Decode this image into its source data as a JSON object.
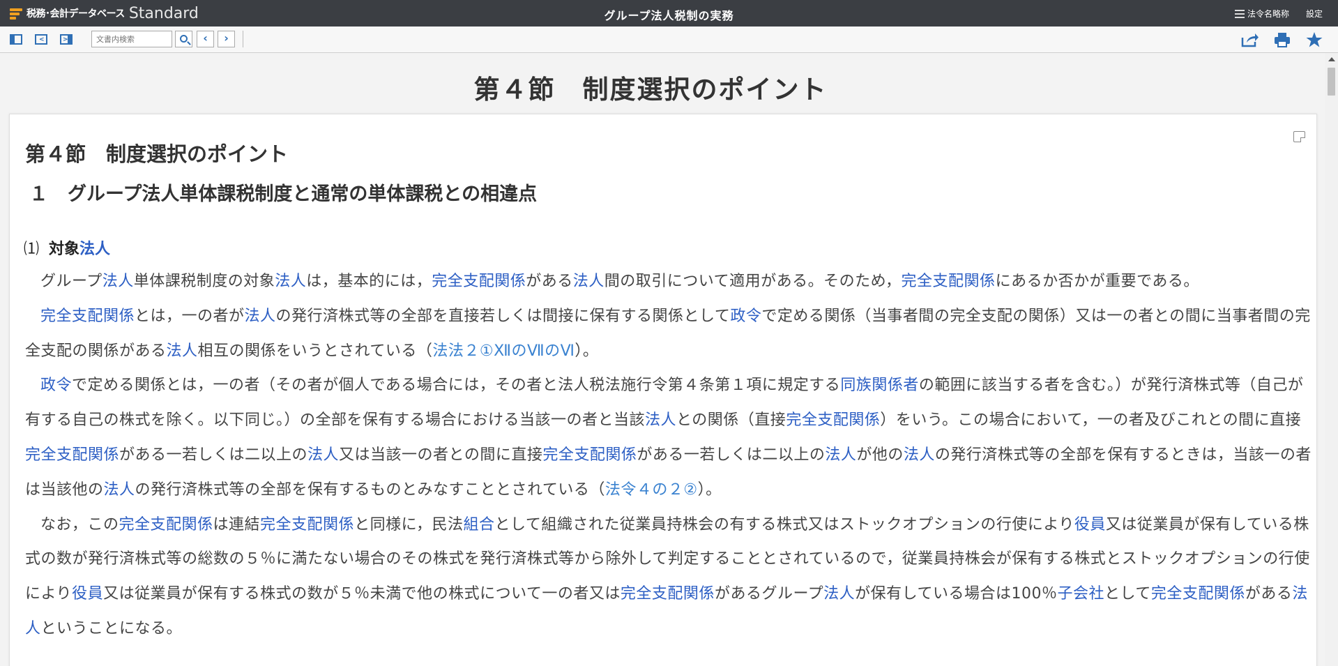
{
  "titlebar": {
    "logo_text": "税務･会計データベース",
    "logo_edition": "Standard",
    "title": "グループ法人税制の実務",
    "law_abbrev_label": "法令名略称",
    "settings_label": "設定"
  },
  "toolbar": {
    "search_placeholder": "文書内検索",
    "prev_symbol": "‹",
    "next_symbol": "›"
  },
  "page": {
    "heading": "第４節　制度選択のポイント",
    "section_title": "第４節　制度選択のポイント",
    "subsection_num": "１",
    "subsection_title": "グループ法人単体課税制度と通常の単体課税との相違点",
    "item_num": "⑴",
    "item_label": "対象",
    "item_link": "法人"
  },
  "colors": {
    "titlebar_bg": "#3b3e43",
    "link": "#2d5fc4",
    "accent": "#2f6fb5",
    "logo_orange": "#f0a020"
  },
  "paragraphs": [
    [
      {
        "t": "グループ"
      },
      {
        "t": "法人",
        "link": true
      },
      {
        "t": "単体課税制度の対象"
      },
      {
        "t": "法人",
        "link": true
      },
      {
        "t": "は，基本的には，"
      },
      {
        "t": "完全支配関係",
        "link": true
      },
      {
        "t": "がある"
      },
      {
        "t": "法人",
        "link": true
      },
      {
        "t": "間の取引について適用がある。そのため，"
      },
      {
        "t": "完全支配関係",
        "link": true
      },
      {
        "t": "にあるか否かが重要である。"
      }
    ],
    [
      {
        "t": "完全支配関係",
        "link": true
      },
      {
        "t": "とは，一の者が"
      },
      {
        "t": "法人",
        "link": true
      },
      {
        "t": "の発行済株式等の全部を直接若しくは間接に保有する関係として"
      },
      {
        "t": "政令",
        "link": true
      },
      {
        "t": "で定める関係（当事者間の完全支配の関係）又は一の者との間に当事者間の完全支配の関係がある"
      },
      {
        "t": "法人",
        "link": true
      },
      {
        "t": "相互の関係をいうとされている（"
      },
      {
        "t": "法法２①ⅫのⅦのⅥ",
        "link": true,
        "ref": true
      },
      {
        "t": "）。"
      }
    ],
    [
      {
        "t": "政令",
        "link": true
      },
      {
        "t": "で定める関係とは，一の者（その者が個人である場合には，その者と法人税法施行令第４条第１項に規定する"
      },
      {
        "t": "同族関係者",
        "link": true
      },
      {
        "t": "の範囲に該当する者を含む。）が発行済株式等（自己が有する自己の株式を除く。以下同じ。）の全部を保有する場合における当該一の者と当該"
      },
      {
        "t": "法人",
        "link": true
      },
      {
        "t": "との関係（直接"
      },
      {
        "t": "完全支配関係",
        "link": true
      },
      {
        "t": "）をいう。この場合において，一の者及びこれとの間に直接"
      },
      {
        "t": "完全支配関係",
        "link": true
      },
      {
        "t": "がある一若しくは二以上の"
      },
      {
        "t": "法人",
        "link": true
      },
      {
        "t": "又は当該一の者との間に直接"
      },
      {
        "t": "完全支配関係",
        "link": true
      },
      {
        "t": "がある一若しくは二以上の"
      },
      {
        "t": "法人",
        "link": true
      },
      {
        "t": "が他の"
      },
      {
        "t": "法人",
        "link": true
      },
      {
        "t": "の発行済株式等の全部を保有するときは，当該一の者は当該他の"
      },
      {
        "t": "法人",
        "link": true
      },
      {
        "t": "の発行済株式等の全部を保有するものとみなすこととされている（"
      },
      {
        "t": "法令４の２②",
        "link": true,
        "ref": true
      },
      {
        "t": "）。"
      }
    ],
    [
      {
        "t": "なお，この"
      },
      {
        "t": "完全支配関係",
        "link": true
      },
      {
        "t": "は連結"
      },
      {
        "t": "完全支配関係",
        "link": true
      },
      {
        "t": "と同様に，民法"
      },
      {
        "t": "組合",
        "link": true
      },
      {
        "t": "として組織された従業員持株会の有する株式又はストックオプションの行使により"
      },
      {
        "t": "役員",
        "link": true
      },
      {
        "t": "又は従業員が保有している株式の数が発行済株式等の総数の５％に満たない場合のその株式を発行済株式等から除外して判定することとされているので，従業員持株会が保有する株式とストックオプションの行使により"
      },
      {
        "t": "役員",
        "link": true
      },
      {
        "t": "又は従業員が保有する株式の数が５％未満で他の株式について一の者又は"
      },
      {
        "t": "完全支配関係",
        "link": true
      },
      {
        "t": "があるグループ"
      },
      {
        "t": "法人",
        "link": true
      },
      {
        "t": "が保有している場合は100％"
      },
      {
        "t": "子会社",
        "link": true
      },
      {
        "t": "として"
      },
      {
        "t": "完全支配関係",
        "link": true
      },
      {
        "t": "がある"
      },
      {
        "t": "法人",
        "link": true
      },
      {
        "t": "ということになる。"
      }
    ]
  ]
}
